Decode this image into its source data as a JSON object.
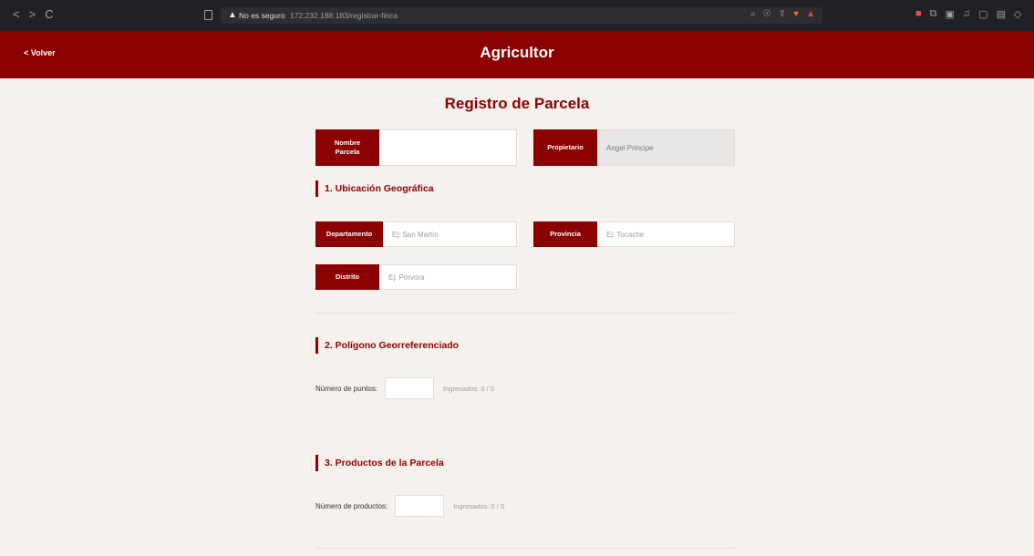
{
  "browser": {
    "nav": [
      "<",
      ">",
      "C"
    ],
    "url_warning": "No es seguro",
    "url": "172.232.188.183/registrar-finca",
    "tool_icons": [
      "⌕",
      "☉",
      "⇧",
      "|"
    ]
  },
  "header": {
    "back_label": "< Volver",
    "title": "Agricultor"
  },
  "form": {
    "title": "Registro de Parcela",
    "nombre_parcela": {
      "label_line1": "Nombre",
      "label_line2": "Parcela",
      "value": ""
    },
    "propietario": {
      "label": "Propietario",
      "value": "Angel Principe"
    },
    "section1": {
      "title": "1. Ubicación Geográfica",
      "departamento": {
        "label": "Departamento",
        "placeholder": "Ej: San Martín"
      },
      "provincia": {
        "label": "Provincia",
        "placeholder": "Ej: Tocache"
      },
      "distrito": {
        "label": "Distrito",
        "placeholder": "Ej: Pórvora"
      }
    },
    "section2": {
      "title": "2. Polígono Georreferenciado",
      "count_label": "Número de puntos:",
      "count_value": "",
      "status": "Ingresados: 0 / 0"
    },
    "section3": {
      "title": "3. Productos de la Parcela",
      "count_label": "Número de productos:",
      "count_value": "",
      "status": "Ingresados: 0 / 0"
    }
  },
  "colors": {
    "primary": "#8b0000",
    "background": "#f6f1ec"
  }
}
